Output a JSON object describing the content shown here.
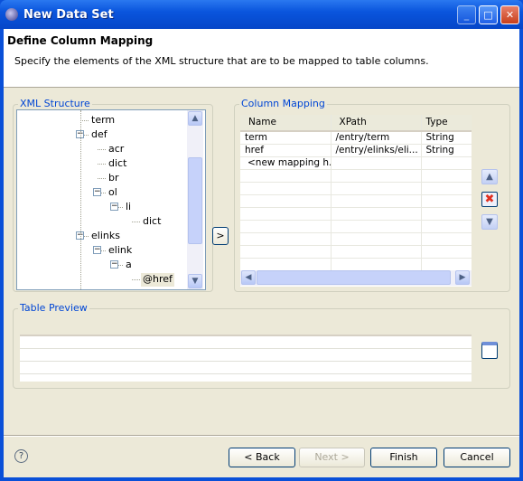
{
  "window": {
    "title": "New Data Set",
    "app_icon": "eclipse-icon",
    "controls": [
      "minimize",
      "maximize",
      "close"
    ]
  },
  "header": {
    "title": "Define Column Mapping",
    "description": "Specify the elements of the XML structure that are to be mapped to table columns."
  },
  "xml_structure": {
    "label": "XML Structure",
    "nodes": [
      {
        "label": "term",
        "expander": false
      },
      {
        "label": "def",
        "expander": true
      },
      {
        "label": "acr",
        "expander": false
      },
      {
        "label": "dict",
        "expander": false
      },
      {
        "label": "br",
        "expander": false
      },
      {
        "label": "ol",
        "expander": true
      },
      {
        "label": "li",
        "expander": true
      },
      {
        "label": "dict",
        "expander": false
      },
      {
        "label": "elinks",
        "expander": true
      },
      {
        "label": "elink",
        "expander": true
      },
      {
        "label": "a",
        "expander": true
      },
      {
        "label": "@href",
        "expander": false,
        "selected": true
      }
    ],
    "add_button": ">"
  },
  "column_mapping": {
    "label": "Column Mapping",
    "columns": [
      "Name",
      "XPath",
      "Type"
    ],
    "rows": [
      [
        "term",
        "/entry/term",
        "String"
      ],
      [
        "href",
        "/entry/elinks/eli...",
        "String"
      ],
      [
        "<new mapping h...",
        "",
        ""
      ]
    ]
  },
  "table_preview": {
    "label": "Table Preview"
  },
  "footer": {
    "back": "< Back",
    "next": "Next >",
    "finish": "Finish",
    "cancel": "Cancel"
  },
  "colors": {
    "titlebar": "#0a55dd",
    "group_label": "#0046d5",
    "dialog_bg": "#ece9d8"
  }
}
